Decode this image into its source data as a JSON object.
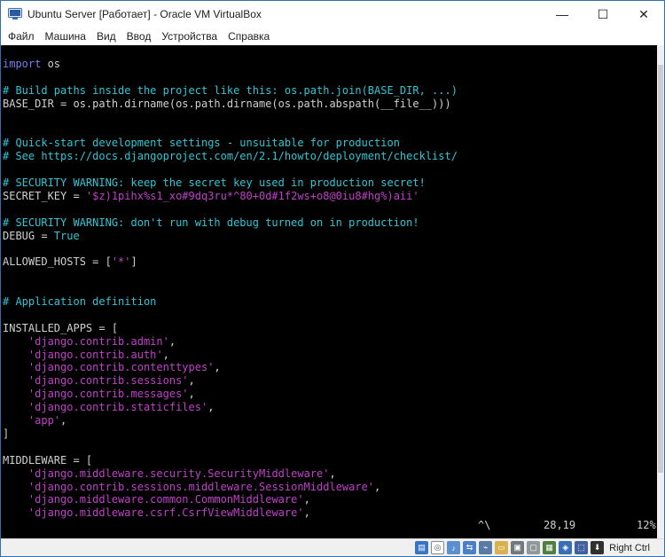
{
  "window": {
    "title": "Ubuntu Server [Работает] - Oracle VM VirtualBox",
    "controls": {
      "minimize": "—",
      "maximize": "☐",
      "close": "✕"
    }
  },
  "menubar": {
    "items": [
      "Файл",
      "Машина",
      "Вид",
      "Ввод",
      "Устройства",
      "Справка"
    ]
  },
  "editor": {
    "l1_kw": "import",
    "l1_rest": " os",
    "l3": "# Build paths inside the project like this: os.path.join(BASE_DIR, ...)",
    "l4": "BASE_DIR = os.path.dirname(os.path.dirname(os.path.abspath(__file__)))",
    "l7": "# Quick-start development settings - unsuitable for production",
    "l8": "# See https://docs.djangoproject.com/en/2.1/howto/deployment/checklist/",
    "l10": "# SECURITY WARNING: keep the secret key used in production secret!",
    "l11_a": "SECRET_KEY = ",
    "l11_s": "'$z)1pihx%s1_xo#9dq3ru*^80+0d#1f2ws+o8@0iu8#hg%)aii'",
    "l13": "# SECURITY WARNING: don't run with debug turned on in production!",
    "l14_a": "DEBUG = ",
    "l14_b": "True",
    "l16_a": "ALLOWED_HOSTS = [",
    "l16_s": "'*'",
    "l16_b": "]",
    "l19": "# Application definition",
    "l21": "INSTALLED_APPS = [",
    "apps": [
      "'django.contrib.admin'",
      "'django.contrib.auth'",
      "'django.contrib.contenttypes'",
      "'django.contrib.sessions'",
      "'django.contrib.messages'",
      "'django.contrib.staticfiles'",
      "'app'"
    ],
    "l29": "]",
    "l31": "MIDDLEWARE = [",
    "mw": [
      "'django.middleware.security.SecurityMiddleware'",
      "'django.contrib.sessions.middleware.SessionMiddleware'",
      "'django.middleware.common.CommonMiddleware'",
      "'django.middleware.csrf.CsrfViewMiddleware'"
    ],
    "comma": ","
  },
  "status": {
    "cmd": "^\\",
    "position": "28,19",
    "percent": "12%"
  },
  "statusbar": {
    "host_key": "Right Ctrl"
  },
  "colors": {
    "comment": "#2ec6d6",
    "string": "#c040c8",
    "keyword": "#7080e8",
    "background": "#000000"
  }
}
